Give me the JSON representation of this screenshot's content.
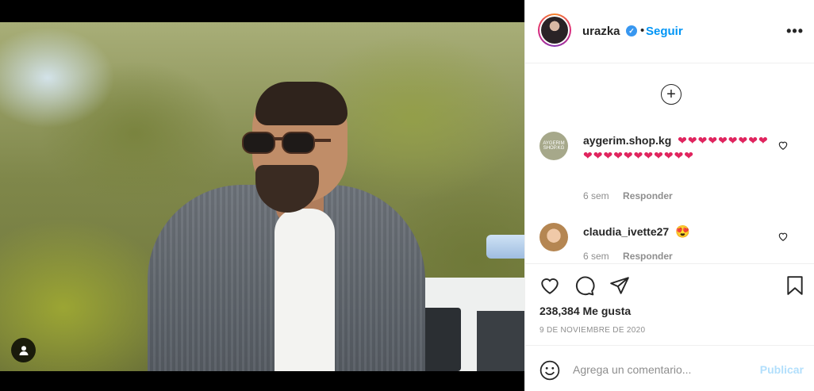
{
  "header": {
    "username": "urazka",
    "verified_badge": "✓",
    "separator": "•",
    "follow_label": "Seguir",
    "more_icon": "more-options-icon"
  },
  "comments": {
    "load_more_icon": "add-circle-icon",
    "items": [
      {
        "user": "aygerim.shop.kg",
        "text": "❤❤❤❤❤❤❤❤❤❤❤❤❤❤❤❤❤❤❤❤",
        "time": "6 sem",
        "reply_label": "Responder"
      },
      {
        "user": "claudia_ivette27",
        "text": "😍",
        "time": "6 sem",
        "reply_label": "Responder"
      }
    ]
  },
  "actions": {
    "like_icon": "heart-icon",
    "comment_icon": "comment-icon",
    "share_icon": "share-icon",
    "save_icon": "bookmark-icon",
    "likes": "238,384 Me gusta",
    "date": "9 DE NOVIEMBRE DE 2020"
  },
  "composer": {
    "placeholder": "Agrega un comentario...",
    "publish_label": "Publicar"
  },
  "colors": {
    "accent": "#0095f6",
    "verified": "#3897f0",
    "heart": "#e0245e",
    "publish_disabled": "#b2dffc"
  }
}
